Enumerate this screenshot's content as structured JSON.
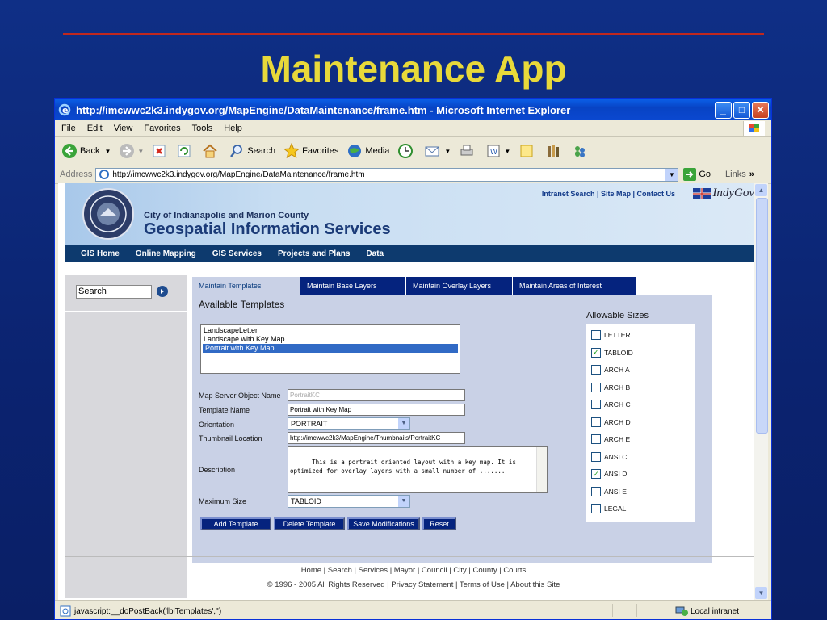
{
  "slide": {
    "title": "Maintenance App"
  },
  "window": {
    "title": "http://imcwwc2k3.indygov.org/MapEngine/DataMaintenance/frame.htm - Microsoft Internet Explorer",
    "menu": [
      "File",
      "Edit",
      "View",
      "Favorites",
      "Tools",
      "Help"
    ],
    "toolbar": {
      "back": "Back",
      "search": "Search",
      "favorites": "Favorites",
      "media": "Media"
    },
    "address_label": "Address",
    "address": "http://imcwwc2k3.indygov.org/MapEngine/DataMaintenance/frame.htm",
    "go": "Go",
    "links": "Links"
  },
  "header": {
    "top_links": "Intranet Search | Site Map | Contact Us",
    "brand": "IndyGov",
    "city": "City of Indianapolis and Marion County",
    "department": "Geospatial Information Services"
  },
  "nav": [
    "GIS Home",
    "Online Mapping",
    "GIS Services",
    "Projects and Plans",
    "Data"
  ],
  "sidebar": {
    "search_value": "Search"
  },
  "tabs": [
    "Maintain Templates",
    "Maintain Base Layers",
    "Maintain Overlay Layers",
    "Maintain Areas of Interest"
  ],
  "form": {
    "available_title": "Available Templates",
    "templates": [
      "LandscapeLetter",
      "Landscape with Key Map",
      "Portrait with Key Map"
    ],
    "selected_template": "Portrait with Key Map",
    "labels": {
      "map_server": "Map Server Object Name",
      "template_name": "Template Name",
      "orientation": "Orientation",
      "thumbnail": "Thumbnail Location",
      "description": "Description",
      "max_size": "Maximum Size"
    },
    "values": {
      "map_server": "PortraitKC",
      "template_name": "Portrait with Key Map",
      "orientation": "PORTRAIT",
      "thumbnail": "http://imcwwc2k3/MapEngine/Thumbnails/PortraitKC",
      "description": "This is a portrait oriented layout with a key map. It is optimized for overlay layers with a small number of .......",
      "max_size": "TABLOID"
    },
    "buttons": [
      "Add Template",
      "Delete Template",
      "Save Modifications",
      "Reset"
    ]
  },
  "sizes": {
    "title": "Allowable Sizes",
    "items": [
      {
        "label": "LETTER",
        "checked": false
      },
      {
        "label": "TABLOID",
        "checked": true
      },
      {
        "label": "ARCH A",
        "checked": false
      },
      {
        "label": "ARCH B",
        "checked": false
      },
      {
        "label": "ARCH C",
        "checked": false
      },
      {
        "label": "ARCH D",
        "checked": false
      },
      {
        "label": "ARCH E",
        "checked": false
      },
      {
        "label": "ANSI C",
        "checked": false
      },
      {
        "label": "ANSI D",
        "checked": true
      },
      {
        "label": "ANSI E",
        "checked": false
      },
      {
        "label": "LEGAL",
        "checked": false
      }
    ]
  },
  "footer": {
    "links": "Home | Search | Services | Mayor | Council | City | County | Courts",
    "copyright": "© 1996 - 2005 All Rights Reserved | Privacy Statement | Terms of Use | About this Site"
  },
  "status": {
    "text": "javascript:__doPostBack('lblTemplates','')",
    "zone": "Local intranet"
  },
  "colors": {
    "title": "#e8d93a",
    "tab_active_bg": "#c9d1e6",
    "tab_bg": "#05237e",
    "nav_bg": "#0d3a6e"
  }
}
